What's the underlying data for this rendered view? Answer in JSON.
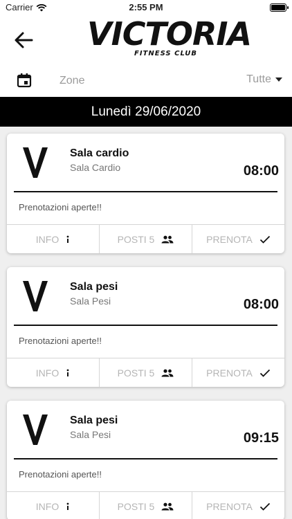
{
  "status_bar": {
    "carrier": "Carrier",
    "time": "2:55 PM"
  },
  "header": {
    "logo_main": "VICTORIA",
    "logo_sub": "FITNESS CLUB"
  },
  "filter": {
    "zone_label": "Zone",
    "zone_value": "Tutte"
  },
  "date_label": "Lunedì 29/06/2020",
  "cards": [
    {
      "title": "Sala cardio",
      "subtitle": "Sala Cardio",
      "time": "08:00",
      "status": "Prenotazioni aperte!!",
      "info_label": "INFO",
      "posti_label": "POSTI 5",
      "prenota_label": "PRENOTA"
    },
    {
      "title": "Sala pesi",
      "subtitle": "Sala Pesi",
      "time": "08:00",
      "status": "Prenotazioni aperte!!",
      "info_label": "INFO",
      "posti_label": "POSTI 5",
      "prenota_label": "PRENOTA"
    },
    {
      "title": "Sala pesi",
      "subtitle": "Sala Pesi",
      "time": "09:15",
      "status": "Prenotazioni aperte!!",
      "info_label": "INFO",
      "posti_label": "POSTI 5",
      "prenota_label": "PRENOTA"
    }
  ],
  "colors": {
    "header_bg": "#ffffff",
    "date_bar_bg": "#000000",
    "muted_text": "#b5b5b5",
    "list_bg": "#efefef"
  },
  "icons": [
    "wifi-icon",
    "battery-icon",
    "back-arrow-icon",
    "calendar-icon",
    "dropdown-caret-icon",
    "victoria-v-logo",
    "info-icon",
    "people-icon",
    "check-icon"
  ]
}
